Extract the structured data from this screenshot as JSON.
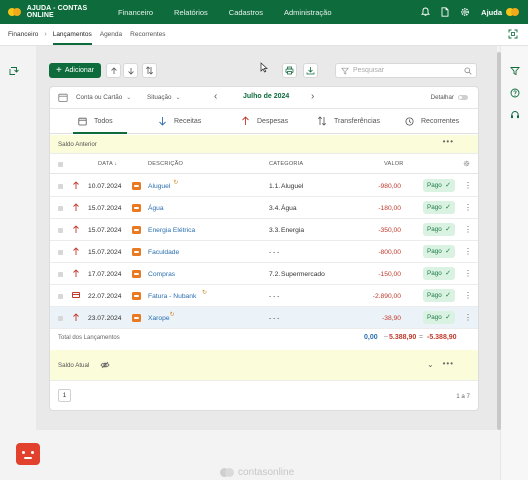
{
  "header": {
    "app_title": "AJUDA - CONTAS ONLINE",
    "nav": [
      "Financeiro",
      "Relatórios",
      "Cadastros",
      "Administração"
    ],
    "help_label": "Ajuda"
  },
  "breadcrumb": {
    "root": "Financeiro",
    "tabs": [
      "Lançamentos",
      "Agenda",
      "Recorrentes"
    ],
    "active_tab": "Lançamentos"
  },
  "toolbar": {
    "add_label": "Adicionar",
    "search_placeholder": "Pesquisar"
  },
  "filters": {
    "account": "Conta ou Cartão",
    "status": "Situação",
    "month": "Julho de 2024",
    "detail_label": "Detalhar",
    "detail_on": false
  },
  "tabs": [
    "Todos",
    "Receitas",
    "Despesas",
    "Transferências",
    "Recorrentes"
  ],
  "opening_balance_label": "Saldo Anterior",
  "table": {
    "headers": {
      "date": "DATA",
      "description": "DESCRIÇÃO",
      "category": "CATEGORIA",
      "value": "VALOR"
    },
    "rows": [
      {
        "date": "10.07.2024",
        "description": "Aluguel",
        "category_code": "1.1.",
        "category": "Aluguel",
        "value": "-980,00",
        "status": "Pago",
        "recurring": true,
        "type": "expense"
      },
      {
        "date": "15.07.2024",
        "description": "Água",
        "category_code": "3.4.",
        "category": "Água",
        "value": "-180,00",
        "status": "Pago",
        "recurring": false,
        "type": "expense"
      },
      {
        "date": "15.07.2024",
        "description": "Energia Elétrica",
        "category_code": "3.3.",
        "category": "Energia",
        "value": "-350,00",
        "status": "Pago",
        "recurring": false,
        "type": "expense"
      },
      {
        "date": "15.07.2024",
        "description": "Faculdade",
        "category_code": "",
        "category": "- - -",
        "value": "-800,00",
        "status": "Pago",
        "recurring": false,
        "type": "expense"
      },
      {
        "date": "17.07.2024",
        "description": "Compras",
        "category_code": "7.2.",
        "category": "Supermercado",
        "value": "-150,00",
        "status": "Pago",
        "recurring": false,
        "type": "expense"
      },
      {
        "date": "22.07.2024",
        "description": "Fatura - Nubank",
        "category_code": "",
        "category": "- - -",
        "value": "-2.890,00",
        "status": "Pago",
        "recurring": true,
        "type": "card"
      },
      {
        "date": "23.07.2024",
        "description": "Xarope",
        "category_code": "",
        "category": "- - -",
        "value": "-38,90",
        "status": "Pago",
        "recurring": true,
        "type": "expense"
      }
    ]
  },
  "totals": {
    "label": "Total dos Lançamentos",
    "income": "0,00",
    "expense": "5.388,90",
    "net": "-5.388,90"
  },
  "current_balance_label": "Saldo Atual",
  "pagination": {
    "page": "1",
    "count": "1 a 7"
  },
  "brand": "contasonline",
  "colors": {
    "primary": "#0d6b3c",
    "expense": "#c0392b",
    "link": "#2a6fb0",
    "band": "#fbfcd9",
    "paid_bg": "#d9f2e2"
  }
}
